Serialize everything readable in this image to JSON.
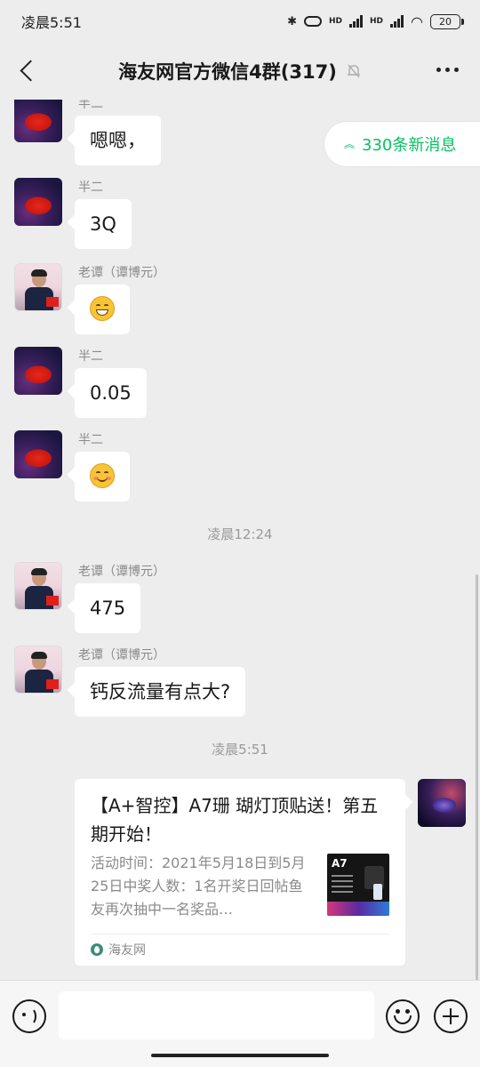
{
  "status_bar": {
    "time": "凌晨5:51",
    "network_1": "HD",
    "network_2": "HD",
    "battery": "20"
  },
  "header": {
    "title": "海友网官方微信4群(317)"
  },
  "new_messages_pill": {
    "label": "330条新消息"
  },
  "messages": [
    {
      "sender": "半二",
      "text": "嗯嗯，",
      "avatar": "red-fish-avatar"
    },
    {
      "sender": "半二",
      "text": "3Q",
      "avatar": "red-fish-avatar"
    },
    {
      "sender": "老谭（谭博元）",
      "text": "",
      "emoji": "grinning-face",
      "avatar": "man-in-suit-avatar"
    },
    {
      "sender": "半二",
      "text": "0.05",
      "avatar": "red-fish-avatar"
    },
    {
      "sender": "半二",
      "text": "",
      "emoji": "smiling-face",
      "avatar": "red-fish-avatar"
    },
    {
      "sender": "老谭（谭博元）",
      "text": "475",
      "avatar": "man-in-suit-avatar"
    },
    {
      "sender": "老谭（谭博元）",
      "text": "钙反流量有点大?",
      "avatar": "man-in-suit-avatar"
    }
  ],
  "timestamps": [
    "凌晨12:24",
    "凌晨5:51"
  ],
  "link_card": {
    "title": "【A+智控】A7珊 瑚灯顶贴送！第五期开始！",
    "description": "活动时间：2021年5月18日到5月25日中奖人数：1名开奖日回帖鱼友再次抽中一名奖品…",
    "thumbnail_label": "A7",
    "source": "海友网"
  },
  "input_bar": {
    "placeholder": ""
  },
  "colors": {
    "background": "#ededed",
    "accent_green": "#07c160",
    "bubble": "#ffffff"
  }
}
